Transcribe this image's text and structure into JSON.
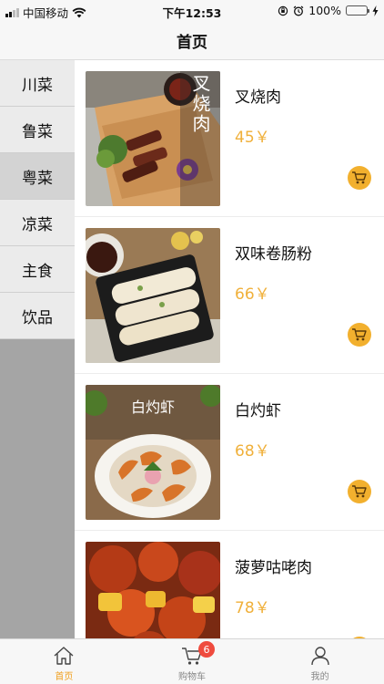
{
  "status_bar": {
    "carrier": "中国移动",
    "time": "下午12:53",
    "battery": "100%"
  },
  "nav": {
    "title": "首页"
  },
  "categories": [
    {
      "label": "川菜"
    },
    {
      "label": "鲁菜"
    },
    {
      "label": "粤菜",
      "active": true
    },
    {
      "label": "凉菜"
    },
    {
      "label": "主食"
    },
    {
      "label": "饮品"
    }
  ],
  "dishes": [
    {
      "name": "叉烧肉",
      "price": "45￥",
      "image": "char-siu-photo",
      "image_text": "叉烧肉"
    },
    {
      "name": "双味卷肠粉",
      "price": "66￥",
      "image": "rice-noodle-roll-photo"
    },
    {
      "name": "白灼虾",
      "price": "68￥",
      "image": "boiled-shrimp-photo",
      "image_text": "白灼虾"
    },
    {
      "name": "菠萝咕咾肉",
      "price": "78￥",
      "image": "sweet-sour-pork-photo"
    }
  ],
  "tabs": [
    {
      "label": "首页",
      "icon": "home-icon",
      "active": true
    },
    {
      "label": "购物车",
      "icon": "cart-icon",
      "badge": "6"
    },
    {
      "label": "我的",
      "icon": "user-icon"
    }
  ],
  "colors": {
    "accent": "#f0b03a",
    "badge": "#ef4b3e",
    "sidebar_active": "#d3d3d3"
  }
}
